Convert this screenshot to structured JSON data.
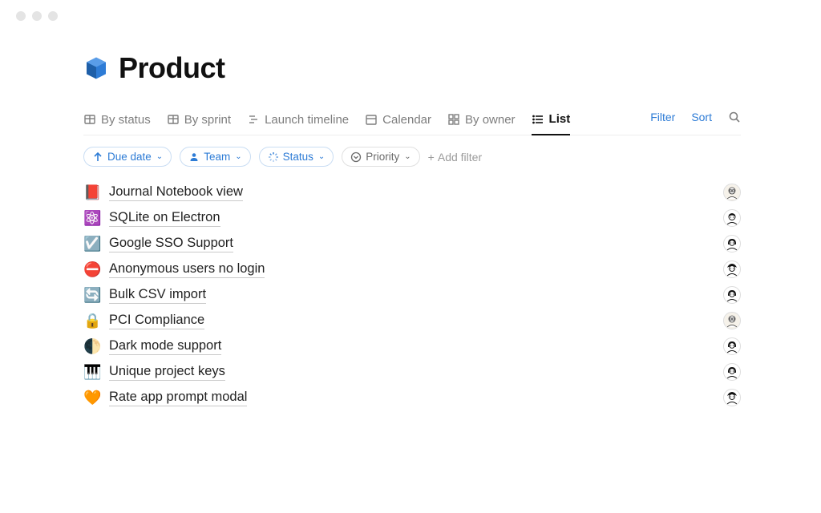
{
  "page": {
    "title": "Product",
    "icon": "📦"
  },
  "tabs": [
    {
      "label": "By status",
      "icon": "table"
    },
    {
      "label": "By sprint",
      "icon": "table"
    },
    {
      "label": "Launch timeline",
      "icon": "timeline"
    },
    {
      "label": "Calendar",
      "icon": "calendar"
    },
    {
      "label": "By owner",
      "icon": "board"
    },
    {
      "label": "List",
      "icon": "list",
      "active": true
    }
  ],
  "tab_actions": {
    "filter": "Filter",
    "sort": "Sort"
  },
  "filters": {
    "due_date": "Due date",
    "team": "Team",
    "status": "Status",
    "priority": "Priority",
    "add": "Add filter"
  },
  "items": [
    {
      "emoji": "📕",
      "title": "Journal Notebook view",
      "avatar": 0
    },
    {
      "emoji": "⚛️",
      "title": "SQLite on Electron",
      "avatar": 1
    },
    {
      "emoji": "☑️",
      "title": "Google SSO Support",
      "avatar": 2
    },
    {
      "emoji": "⛔",
      "title": "Anonymous users no login",
      "avatar": 3
    },
    {
      "emoji": "🔄",
      "title": "Bulk CSV import",
      "avatar": 2
    },
    {
      "emoji": "🔒",
      "title": "PCI Compliance",
      "avatar": 0
    },
    {
      "emoji": "🌓",
      "title": "Dark mode support",
      "avatar": 2
    },
    {
      "emoji": "🎹",
      "title": "Unique project keys",
      "avatar": 2
    },
    {
      "emoji": "🧡",
      "title": "Rate app prompt modal",
      "avatar": 3
    }
  ]
}
